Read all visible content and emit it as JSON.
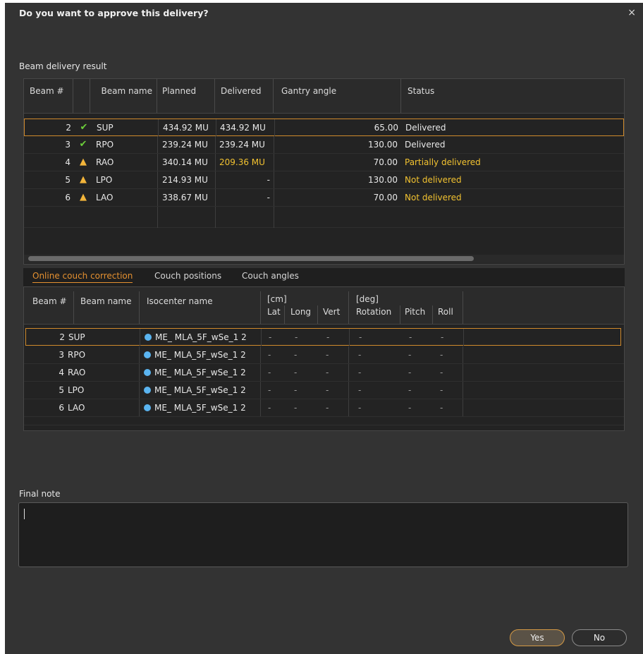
{
  "dialog": {
    "title": "Do you want to approve this delivery?",
    "close_icon": "×"
  },
  "beam_result": {
    "label": "Beam delivery result",
    "headers": [
      "Beam #",
      "Beam name",
      "Planned",
      "Delivered",
      "Gantry angle",
      "Status"
    ],
    "rows": [
      {
        "num": "2",
        "icon": "check-icon",
        "glyph": "✔",
        "name": "SUP",
        "planned": "434.92 MU",
        "delivered": "434.92 MU",
        "gantry": "65.00",
        "status": "Delivered"
      },
      {
        "num": "3",
        "icon": "check-icon",
        "glyph": "✔",
        "name": "RPO",
        "planned": "239.24 MU",
        "delivered": "239.24 MU",
        "gantry": "130.00",
        "status": "Delivered"
      },
      {
        "num": "4",
        "icon": "warning-icon",
        "glyph": "▲",
        "name": "RAO",
        "planned": "340.14 MU",
        "delivered": "209.36 MU",
        "gantry": "70.00",
        "status": "Partially delivered"
      },
      {
        "num": "5",
        "icon": "warning-icon",
        "glyph": "▲",
        "name": "LPO",
        "planned": "214.93 MU",
        "delivered": "-",
        "gantry": "130.00",
        "status": "Not delivered"
      },
      {
        "num": "6",
        "icon": "warning-icon",
        "glyph": "▲",
        "name": "LAO",
        "planned": "338.67 MU",
        "delivered": "-",
        "gantry": "70.00",
        "status": "Not delivered"
      }
    ]
  },
  "tabs": [
    "Online couch correction",
    "Couch positions",
    "Couch angles"
  ],
  "couch": {
    "headers": {
      "beam_num": "Beam #",
      "beam_name": "Beam name",
      "iso": "Isocenter name",
      "cm": "[cm]",
      "lat": "Lat",
      "long": "Long",
      "vert": "Vert",
      "deg": "[deg]",
      "rotation": "Rotation",
      "pitch": "Pitch",
      "roll": "Roll"
    },
    "rows": [
      {
        "num": "2",
        "name": "SUP",
        "iso": "ME_ MLA_5F_wSe_1 2",
        "lat": "-",
        "long": "-",
        "vert": "-",
        "rotation": "-",
        "pitch": "-",
        "roll": "-"
      },
      {
        "num": "3",
        "name": "RPO",
        "iso": "ME_ MLA_5F_wSe_1 2",
        "lat": "-",
        "long": "-",
        "vert": "-",
        "rotation": "-",
        "pitch": "-",
        "roll": "-"
      },
      {
        "num": "4",
        "name": "RAO",
        "iso": "ME_ MLA_5F_wSe_1 2",
        "lat": "-",
        "long": "-",
        "vert": "-",
        "rotation": "-",
        "pitch": "-",
        "roll": "-"
      },
      {
        "num": "5",
        "name": "LPO",
        "iso": "ME_ MLA_5F_wSe_1 2",
        "lat": "-",
        "long": "-",
        "vert": "-",
        "rotation": "-",
        "pitch": "-",
        "roll": "-"
      },
      {
        "num": "6",
        "name": "LAO",
        "iso": "ME_ MLA_5F_wSe_1 2",
        "lat": "-",
        "long": "-",
        "vert": "-",
        "rotation": "-",
        "pitch": "-",
        "roll": "-"
      }
    ]
  },
  "final_note": {
    "label": "Final note",
    "value": ""
  },
  "buttons": {
    "yes": "Yes",
    "no": "No"
  },
  "colors": {
    "accent": "#e49030",
    "warning_text": "#f2c230",
    "success": "#6ccf3a",
    "isocenter_dot": "#5ab4f0"
  }
}
